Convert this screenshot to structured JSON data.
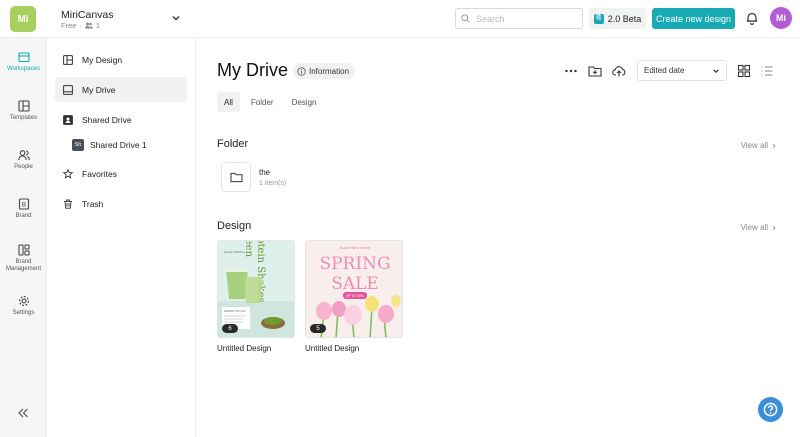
{
  "header": {
    "logo_text": "Mi",
    "workspace_name": "MiriCanvas",
    "plan": "Free",
    "member_count": "1",
    "search_placeholder": "Search",
    "beta_label": "2.0 Beta",
    "create_label": "Create new design",
    "avatar_initials": "Mi"
  },
  "rail": {
    "items": [
      {
        "label": "Workspaces",
        "icon": "workspaces-icon"
      },
      {
        "label": "Templates",
        "icon": "templates-icon"
      },
      {
        "label": "People",
        "icon": "people-icon"
      },
      {
        "label": "Brand",
        "icon": "brand-icon"
      },
      {
        "label": "Brand Management",
        "icon": "brand-management-icon"
      },
      {
        "label": "Settings",
        "icon": "gear-icon"
      }
    ]
  },
  "nav": {
    "my_design": "My Design",
    "my_drive": "My Drive",
    "shared_drive": "Shared Drive",
    "shared_drive_1_badge": "Sh",
    "shared_drive_1": "Shared Drive 1",
    "favorites": "Favorites",
    "trash": "Trash"
  },
  "main": {
    "title": "My Drive",
    "info_label": "Information",
    "sort_value": "Edited date",
    "tabs": [
      {
        "label": "All"
      },
      {
        "label": "Folder"
      },
      {
        "label": "Design"
      }
    ],
    "folder_section": {
      "title": "Folder",
      "view_all": "View all",
      "items": [
        {
          "name": "the",
          "count": "1 item(s)"
        }
      ]
    },
    "design_section": {
      "title": "Design",
      "view_all": "View all",
      "items": [
        {
          "title": "Untitled Design",
          "pages": "6"
        },
        {
          "title": "Untitled Design",
          "pages": "5"
        }
      ]
    }
  },
  "thumb1": {
    "tag": "Green Matcha",
    "headline_1": "Protein Shakes",
    "headline_2": "Green",
    "box_title": "GREEN TO GO"
  },
  "thumb2": {
    "kicker": "BLOOM INTO FRESH",
    "line_1": "SPRING",
    "line_2": "SALE",
    "badge": "UP TO 40%"
  },
  "colors": {
    "accent": "#17aab5",
    "avatar": "#b35ad6",
    "logo": "#a6cf5e",
    "help": "#3a8fd9"
  }
}
